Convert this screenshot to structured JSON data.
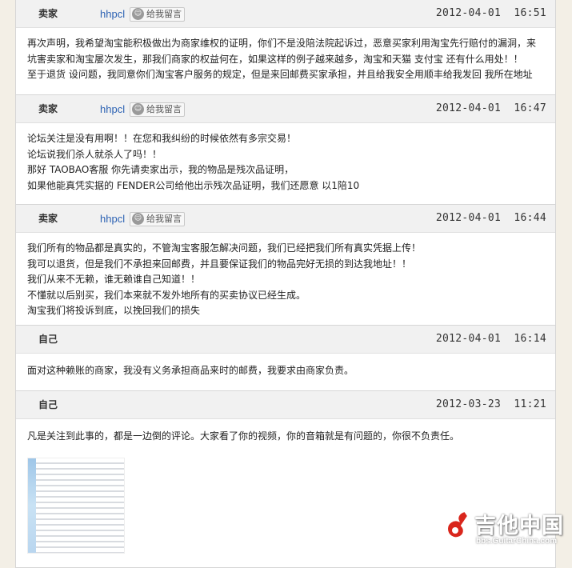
{
  "posts": [
    {
      "author": "卖家",
      "username": "hhpcl",
      "msg_btn": "给我留言",
      "time": "2012-04-01  16:51",
      "lines": [
        "再次声明，我希望淘宝能积极做出为商家维权的证明，你们不是没陪法院起诉过，恶意买家利用淘宝先行赔付的漏洞，来",
        "坑害卖家和淘宝屡次发生，那我们商家的权益何在，如果这样的例子越来越多，淘宝和天猫 支付宝 还有什么用处！！",
        "至于退货 设问题，我同意你们淘宝客户服务的规定，但是来回邮费买家承担，并且给我安全用顺丰给我发回 我所在地址"
      ]
    },
    {
      "author": "卖家",
      "username": "hhpcl",
      "msg_btn": "给我留言",
      "time": "2012-04-01  16:47",
      "lines": [
        "论坛关注是没有用啊！！在您和我纠纷的时候依然有多宗交易！",
        "论坛说我们杀人就杀人了吗！！",
        "那好 TAOBAO客服  你先请卖家出示，我的物品是残次品证明，",
        "如果他能真凭实据的 FENDER公司给他出示残次品证明，我们还愿意  以1陪10"
      ]
    },
    {
      "author": "卖家",
      "username": "hhpcl",
      "msg_btn": "给我留言",
      "time": "2012-04-01  16:44",
      "lines": [
        "我们所有的物品都是真实的，不管淘宝客服怎解决问题，我们已经把我们所有真实凭据上传！",
        "我可以退货，但是我们不承担来回邮费，并且要保证我们的物品完好无损的到达我地址！！",
        "我们从来不无赖，谁无赖谁自己知道！！",
        "不懂就以后别买，我们本来就不发外地所有的买卖协议已经生成。",
        "淘宝我们将投诉到底，以挽回我们的损失"
      ]
    },
    {
      "author": "自己",
      "time": "2012-04-01  16:14",
      "lines": [
        "面对这种赖账的商家，我没有义务承担商品来时的邮费，我要求由商家负责。"
      ]
    },
    {
      "author": "自己",
      "time": "2012-03-23  11:21",
      "lines": [
        "凡是关注到此事的，都是一边倒的评论。大家看了你的视频，你的音箱就是有问题的，你很不负责任。"
      ]
    }
  ],
  "watermark": {
    "name": "吉他中国",
    "url": "bbs.GuitarChina.com"
  },
  "colors": {
    "page_bg": "#f3efe6",
    "header_bg": "#f1f1f1",
    "username": "#2c62b3"
  }
}
